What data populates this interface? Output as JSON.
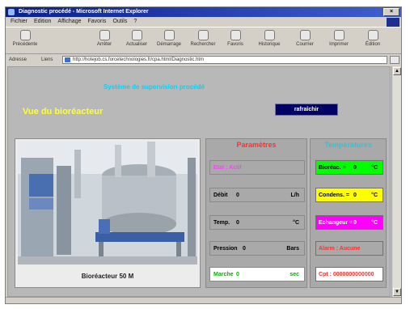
{
  "browser": {
    "title": "Diagnostic procédé - Microsoft Internet Explorer",
    "menu": [
      "Fichier",
      "Edition",
      "Affichage",
      "Favoris",
      "Outils",
      "?"
    ],
    "toolbar": [
      {
        "label": "Précédente",
        "icon": "back-arrow-icon"
      },
      {
        "label": "Arrêter",
        "icon": "stop-icon"
      },
      {
        "label": "Actualiser",
        "icon": "refresh-icon"
      },
      {
        "label": "Démarrage",
        "icon": "home-icon"
      },
      {
        "label": "Rechercher",
        "icon": "search-icon"
      },
      {
        "label": "Favoris",
        "icon": "favorites-icon"
      },
      {
        "label": "Historique",
        "icon": "history-icon"
      },
      {
        "label": "Courrier",
        "icon": "mail-icon"
      },
      {
        "label": "Imprimer",
        "icon": "print-icon"
      },
      {
        "label": "Édition",
        "icon": "edit-icon"
      }
    ],
    "address_label": "Adresse",
    "links_label": "Liens",
    "url": "http://hotejob.cs.forcetechnologies.fr/cpa.html/Diagnostic.htm",
    "status": ""
  },
  "page": {
    "header_caption": "Système de supervision procédé",
    "subtitle": "Vue du bioréacteur",
    "refresh_button": "rafraîchir",
    "photo_caption": "Bioréacteur 50 M",
    "params": {
      "heading": "Paramètres",
      "rows": [
        {
          "label": "Etat : Actif",
          "value": "",
          "unit": "",
          "color": "#ff40ff",
          "bg": "#a9a9a9"
        },
        {
          "label": "Débit",
          "value": "0",
          "unit": "L/h",
          "color": "#000000",
          "bg": "#a9a9a9"
        },
        {
          "label": "Temp.",
          "value": "0",
          "unit": "°C",
          "color": "#000000",
          "bg": "#a9a9a9"
        },
        {
          "label": "Pression",
          "value": "0",
          "unit": "Bars",
          "color": "#000000",
          "bg": "#a9a9a9"
        },
        {
          "label": "Marche",
          "value": "0",
          "unit": "sec",
          "color": "#00b000",
          "bg": "#ffffff"
        }
      ]
    },
    "temps": {
      "heading": "Températures",
      "rows": [
        {
          "label": "Bioréac. =",
          "value": "0",
          "unit": "°C",
          "color": "#000000",
          "bg": "#00ff00"
        },
        {
          "label": "Condens. =",
          "value": "0",
          "unit": "°C",
          "color": "#000000",
          "bg": "#ffff00"
        },
        {
          "label": "Echangeur =",
          "value": "0",
          "unit": "°C",
          "color": "#ffffff",
          "bg": "#ff00ff"
        },
        {
          "label": "Alarm : Aucune",
          "value": "",
          "unit": "",
          "color": "#ff3030",
          "bg": "#a9a9a9"
        },
        {
          "label": "Cpt : 0000000000000",
          "value": "",
          "unit": "",
          "color": "#ff3030",
          "bg": "#ffffff"
        }
      ]
    }
  }
}
